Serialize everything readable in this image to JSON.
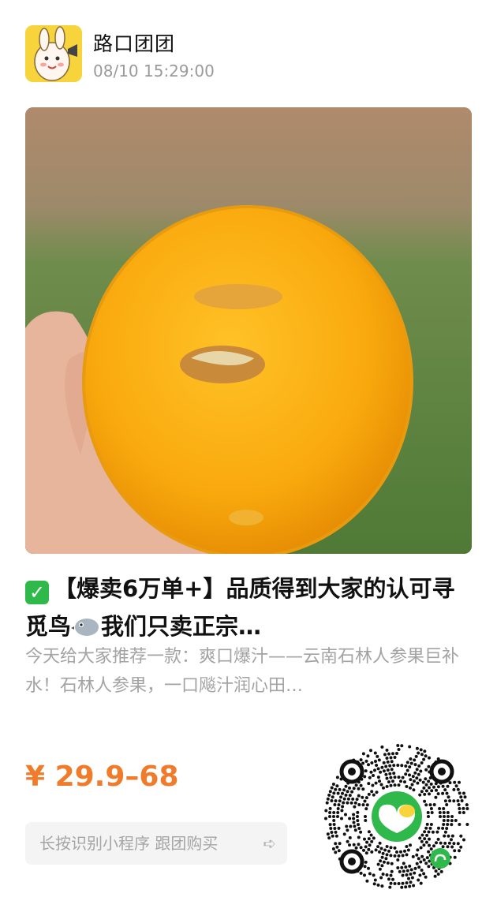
{
  "header": {
    "shop_name": "路口团团",
    "post_time": "08/10 15:29:00",
    "avatar_icon": "cartoon-mascot-icon"
  },
  "product": {
    "image_description": "",
    "title": "【爆卖6万单+】品质得到大家的认可寻觅鸟",
    "title_tail": "我们只卖正宗…",
    "description": "今天给大家推荐一款：爽口爆汁——云南石林人参果巨补水！石林人参果，一口飚汁润心田…",
    "price": "¥ 29.9–68"
  },
  "cta": {
    "label": "长按识别小程序  跟团购买",
    "arrow_icon": "hand-pointer-icon"
  },
  "qr": {
    "icon": "mini-program-qr-code",
    "center_logo": "group-buy-logo-icon"
  },
  "colors": {
    "price": "#f07b2a",
    "check": "#2fb94a",
    "avatar_bg": "#f7d33c",
    "qr_logo": "#2fb94a"
  }
}
